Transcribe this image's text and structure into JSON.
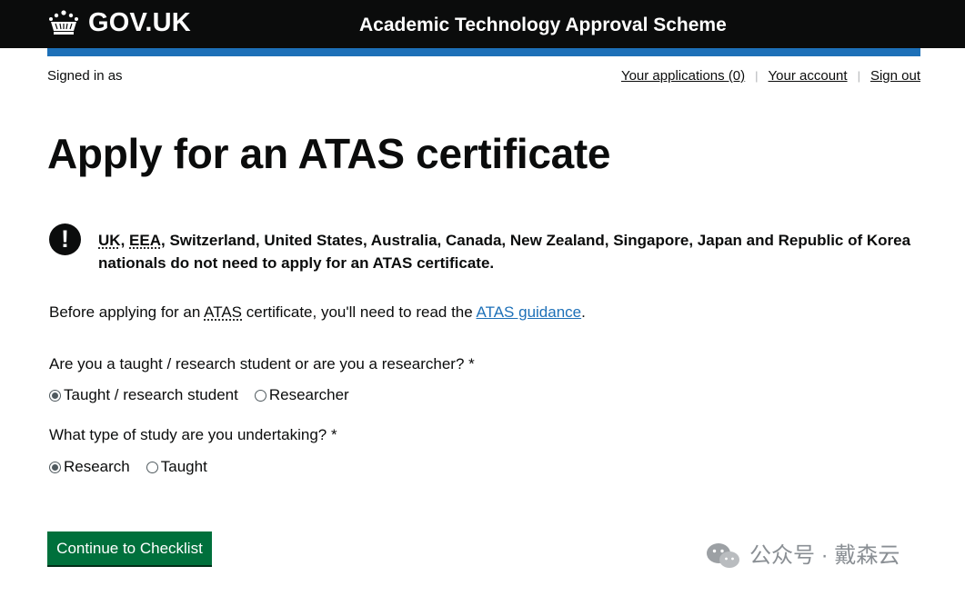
{
  "header": {
    "logo_text": "GOV.UK",
    "service_name": "Academic Technology Approval Scheme",
    "brand_color": "#0b0c0c",
    "accent_color": "#1d70b8"
  },
  "account": {
    "signed_in_text": "Signed in as",
    "nav": [
      {
        "label": "Your applications (0)"
      },
      {
        "label": "Your account"
      },
      {
        "label": "Sign out"
      }
    ],
    "separator": "|"
  },
  "page": {
    "title": "Apply for an ATAS certificate"
  },
  "warning": {
    "icon": "!",
    "abbr1": "UK",
    "sep1": ",",
    "abbr2": "EEA",
    "text": ", Switzerland, United States, Australia, Canada, New Zealand, Singapore, Japan and Republic of Korea nationals do not need to apply for an ATAS certificate."
  },
  "intro": {
    "before": "Before applying for an",
    "abbr": "ATAS",
    "middle": "certificate, you'll need to read the",
    "link": "ATAS guidance",
    "after": "."
  },
  "questions": [
    {
      "label": "Are you a taught / research student or are you a researcher? *",
      "options": [
        {
          "label": "Taught / research student",
          "selected": true
        },
        {
          "label": "Researcher",
          "selected": false
        }
      ]
    },
    {
      "label": "What type of study are you undertaking? *",
      "options": [
        {
          "label": "Research",
          "selected": true
        },
        {
          "label": "Taught",
          "selected": false
        }
      ]
    }
  ],
  "actions": {
    "continue_label": "Continue to Checklist",
    "button_color": "#00703c"
  },
  "watermark": {
    "text": "公众号 · 戴森云"
  }
}
